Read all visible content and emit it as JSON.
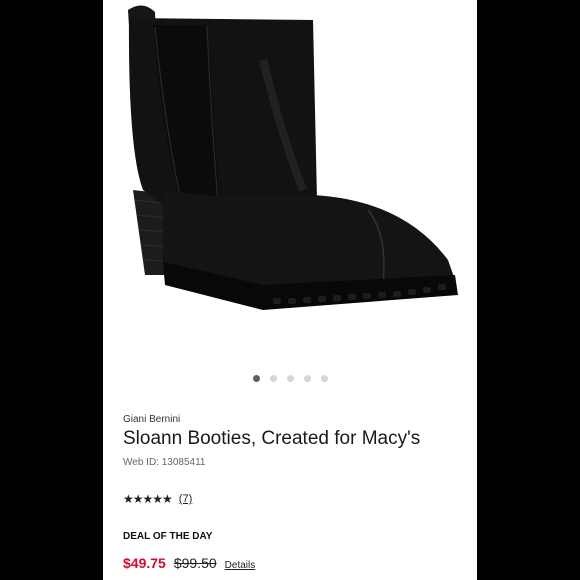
{
  "product": {
    "image_alt": "black ankle boot",
    "brand": "Giani Bernini",
    "title": "Sloann Booties, Created for Macy's",
    "web_id": "Web ID: 13085411",
    "stars_glyphs": "★★★★★",
    "rating_value": 4.5,
    "rating_max": 5,
    "review_count": "(7)"
  },
  "carousel": {
    "total": 5,
    "active_index": 0
  },
  "deal": {
    "label": "DEAL OF THE DAY",
    "sale_price": "$49.75",
    "original_price": "$99.50",
    "details_label": "Details"
  },
  "colors": {
    "sale": "#d30a2e",
    "background": "#000000"
  }
}
